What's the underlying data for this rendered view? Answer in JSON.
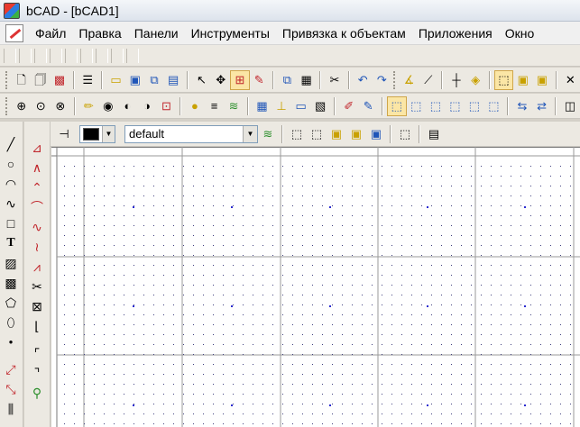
{
  "window": {
    "title": "bCAD - [bCAD1]"
  },
  "menu": {
    "items": [
      "Файл",
      "Правка",
      "Панели",
      "Инструменты",
      "Привязка к объектам",
      "Приложения",
      "Окно"
    ]
  },
  "properties": {
    "color_value": "#000000",
    "layer_value": "default"
  },
  "icons": {
    "toolbar1": [
      "new-doc-icon",
      "copy-doc-icon",
      "image-icon",
      "list-icon",
      "open-folder-icon",
      "save-icon",
      "save-as-icon",
      "save-all-icon",
      "select-arrow-icon",
      "pick-icon",
      "node-select-icon",
      "eraser-icon",
      "copy-icon",
      "paste-icon",
      "cut-icon",
      "undo-icon",
      "redo-icon",
      "angle-icon",
      "pen-icon",
      "crosshair-icon",
      "snap-icon",
      "box3d-1-icon",
      "box3d-2-icon",
      "box3d-3-icon",
      "cross-icon"
    ],
    "toolbar2": [
      "zoom-in-icon",
      "zoom-window-icon",
      "zoom-out-icon",
      "pencil-icon",
      "eye-icon",
      "camera-icon",
      "eye2-icon",
      "target-icon",
      "palette-icon",
      "lines-icon",
      "layers-icon",
      "table-icon",
      "dims-icon",
      "ruler-icon",
      "picture-icon",
      "paint-icon",
      "brush-icon",
      "view-front-icon",
      "view-top-icon",
      "view-left-icon",
      "view-iso1-icon",
      "view-iso2-icon",
      "view-iso3-icon",
      "view-swap1-icon",
      "view-swap2-icon",
      "panel-icon"
    ],
    "vbar1": [
      "line-tool-icon",
      "circle-tool-icon",
      "arc-tool-icon",
      "spline-tool-icon",
      "rect-tool-icon",
      "text-tool-icon",
      "hatch-tool-icon",
      "fill-tool-icon",
      "polygon-tool-icon",
      "ellipse-tool-icon",
      "point-tool-icon",
      "move-tool-icon",
      "copy-tool-icon",
      "array-tool-icon"
    ],
    "vbar2": [
      "polyline-icon",
      "angle-line-icon",
      "broken-line-icon",
      "curve-icon",
      "wave-icon",
      "zigzag-icon",
      "zigzag2-icon",
      "scissors-icon",
      "frame-icon",
      "corner-icon",
      "fillet-icon",
      "fillet-r-icon",
      "brush-tool-icon"
    ]
  }
}
